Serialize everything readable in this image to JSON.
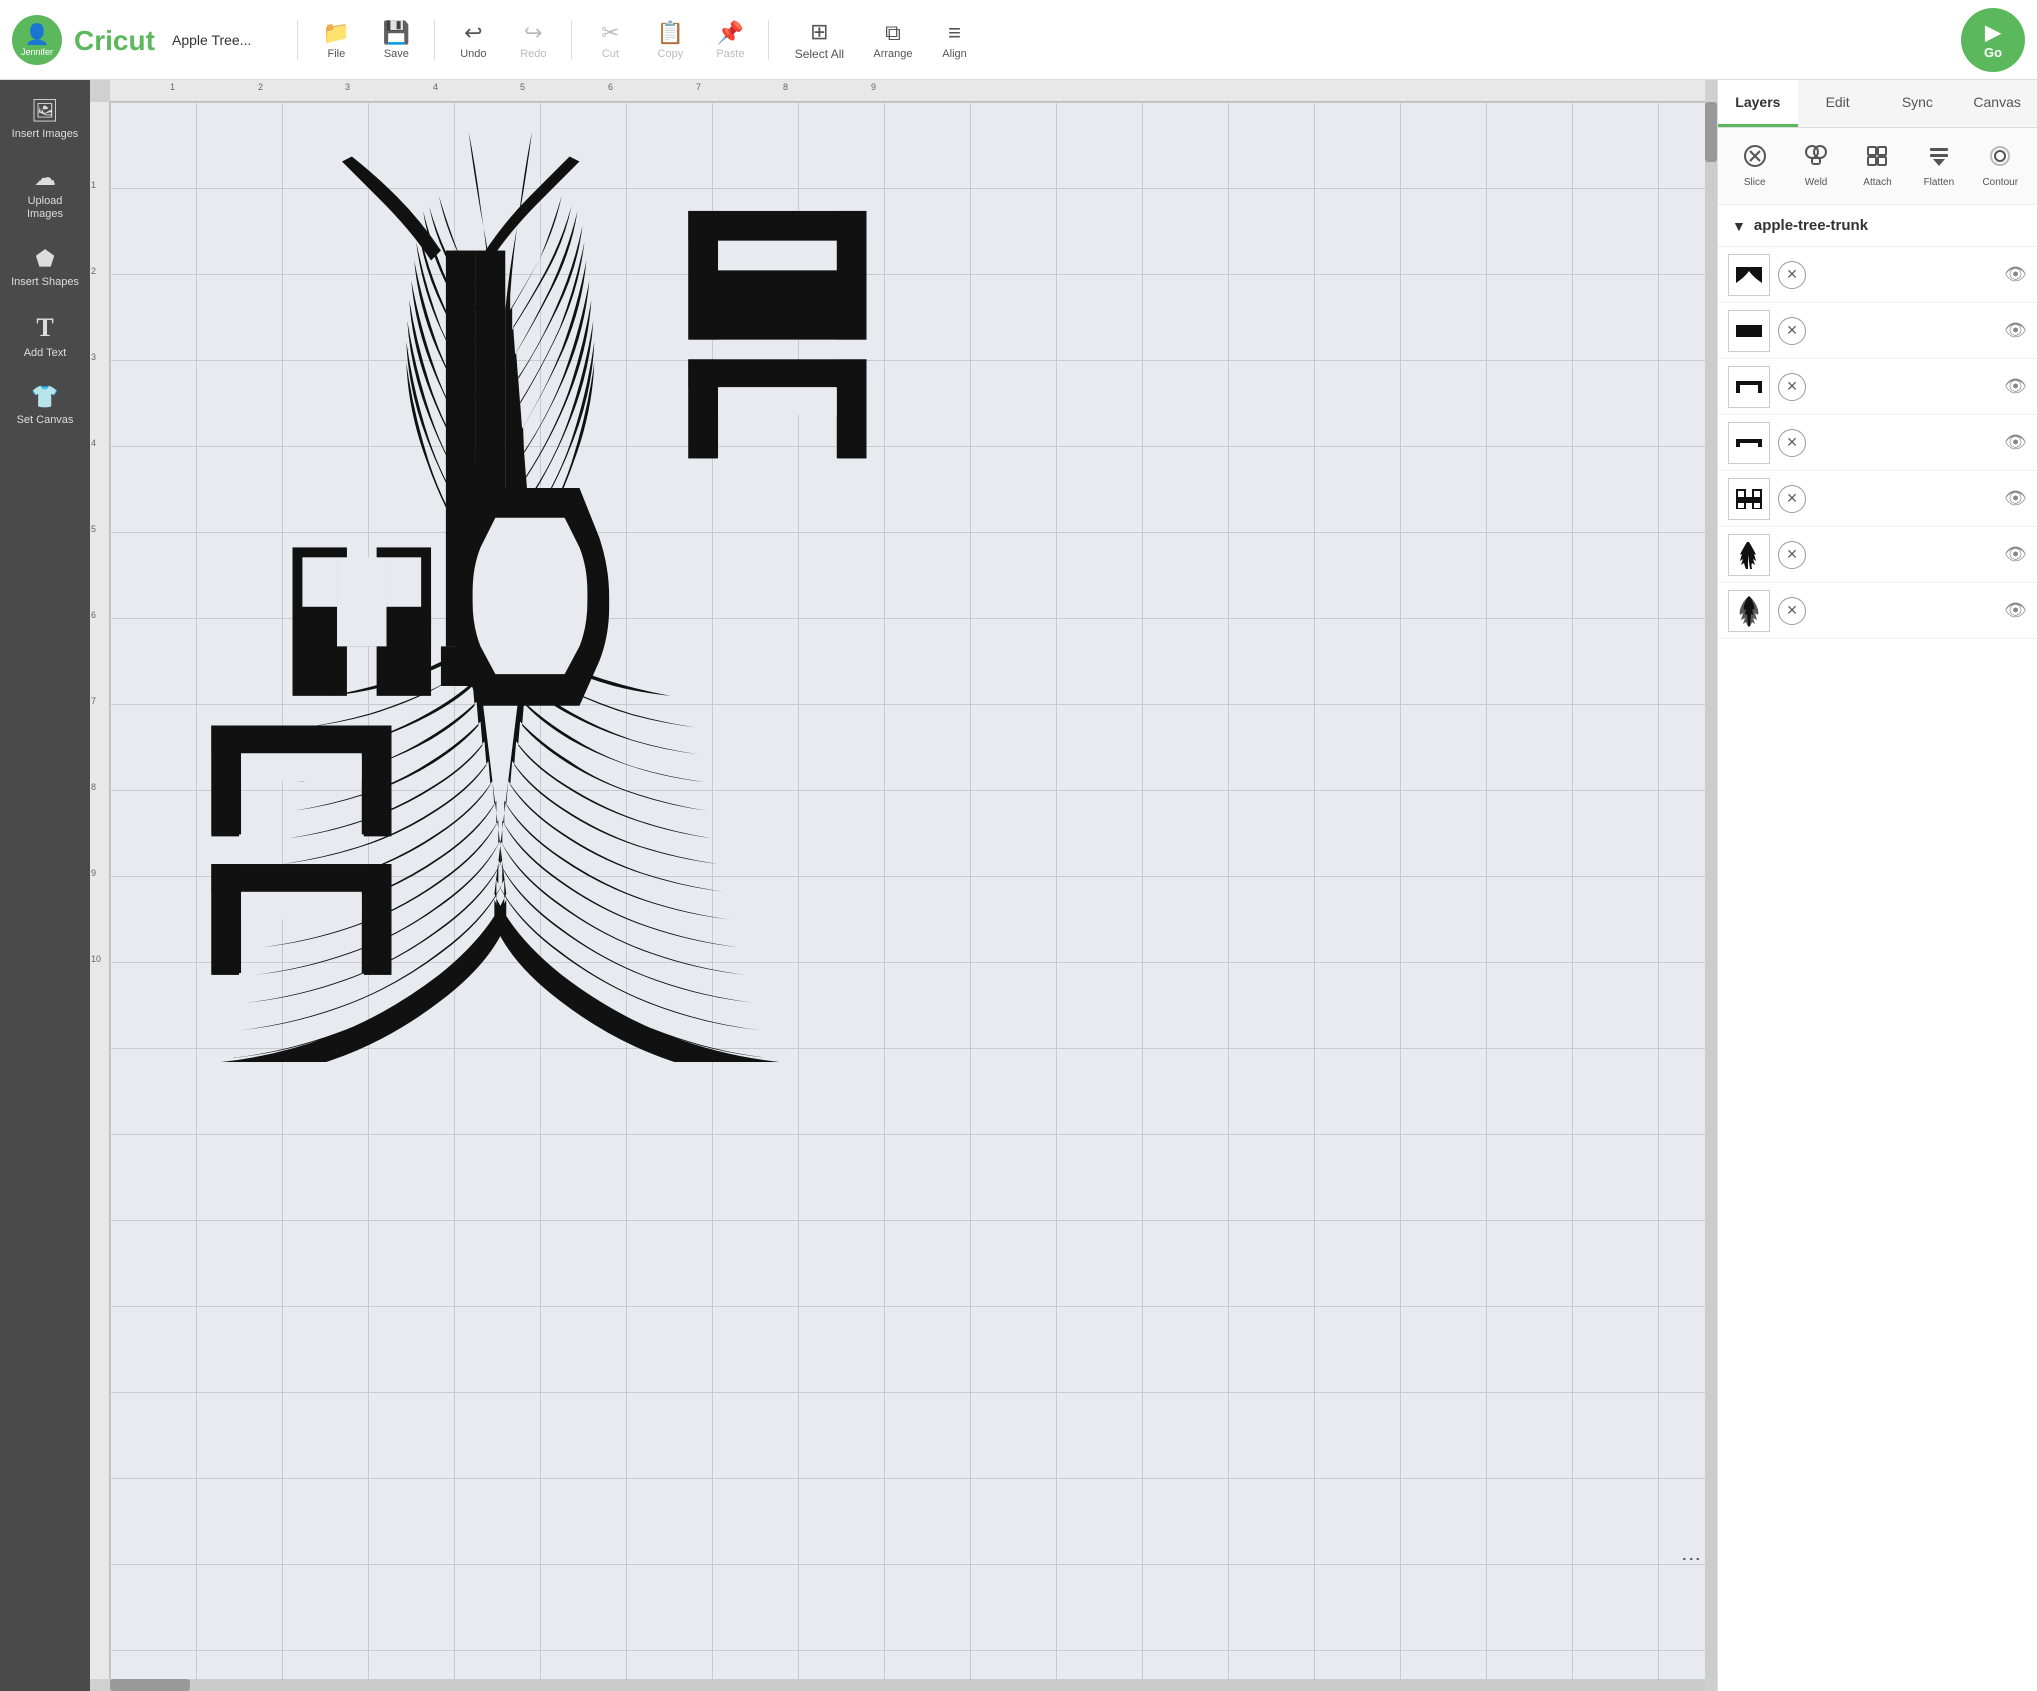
{
  "topbar": {
    "doc_title": "Apple Tree...",
    "cricut_text": "Cricut",
    "file_label": "File",
    "save_label": "Save",
    "undo_label": "Undo",
    "redo_label": "Redo",
    "cut_label": "Cut",
    "copy_label": "Copy",
    "paste_label": "Paste",
    "select_all_label": "Select All",
    "arrange_label": "Arrange",
    "align_label": "Align",
    "go_label": "Go",
    "user_name": "Jennifer"
  },
  "sidebar": {
    "items": [
      {
        "id": "insert-images",
        "label": "Insert\nImages",
        "icon": "🖼"
      },
      {
        "id": "upload-images",
        "label": "Upload\nImages",
        "icon": "☁"
      },
      {
        "id": "insert-shapes",
        "label": "Insert\nShapes",
        "icon": "⬟"
      },
      {
        "id": "add-text",
        "label": "Add Text",
        "icon": "T"
      },
      {
        "id": "set-canvas",
        "label": "Set Canvas",
        "icon": "👕"
      }
    ]
  },
  "right_panel": {
    "tabs": [
      {
        "id": "layers",
        "label": "Layers",
        "active": true
      },
      {
        "id": "edit",
        "label": "Edit",
        "active": false
      },
      {
        "id": "sync",
        "label": "Sync",
        "active": false
      },
      {
        "id": "canvas",
        "label": "Canvas",
        "active": false
      }
    ],
    "tools": [
      {
        "id": "slice",
        "label": "Slice",
        "icon": "✂",
        "disabled": false
      },
      {
        "id": "weld",
        "label": "Weld",
        "icon": "⧖",
        "disabled": false
      },
      {
        "id": "attach",
        "label": "Attach",
        "icon": "📎",
        "disabled": false
      },
      {
        "id": "flatten",
        "label": "Flatten",
        "icon": "⬇",
        "disabled": false
      },
      {
        "id": "contour",
        "label": "Contour",
        "icon": "⊙",
        "disabled": false
      }
    ],
    "group_name": "apple-tree-trunk",
    "layers": [
      {
        "id": 1,
        "thumb": "🌉",
        "has_x": true,
        "visible": true
      },
      {
        "id": 2,
        "thumb": "🌉",
        "has_x": true,
        "visible": true
      },
      {
        "id": 3,
        "thumb": "🌉",
        "has_x": true,
        "visible": true
      },
      {
        "id": 4,
        "thumb": "🌉",
        "has_x": true,
        "visible": true
      },
      {
        "id": 5,
        "thumb": "H",
        "has_x": true,
        "visible": true
      },
      {
        "id": 6,
        "thumb": "🌲",
        "has_x": true,
        "visible": true
      },
      {
        "id": 7,
        "thumb": "🌳",
        "has_x": true,
        "visible": true
      }
    ]
  }
}
